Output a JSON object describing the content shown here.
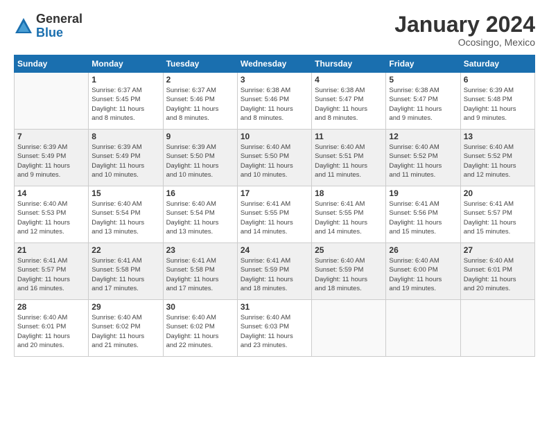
{
  "logo": {
    "general": "General",
    "blue": "Blue"
  },
  "title": "January 2024",
  "subtitle": "Ocosingo, Mexico",
  "days_header": [
    "Sunday",
    "Monday",
    "Tuesday",
    "Wednesday",
    "Thursday",
    "Friday",
    "Saturday"
  ],
  "weeks": [
    {
      "alt": false,
      "days": [
        {
          "num": "",
          "info": ""
        },
        {
          "num": "1",
          "info": "Sunrise: 6:37 AM\nSunset: 5:45 PM\nDaylight: 11 hours\nand 8 minutes."
        },
        {
          "num": "2",
          "info": "Sunrise: 6:37 AM\nSunset: 5:46 PM\nDaylight: 11 hours\nand 8 minutes."
        },
        {
          "num": "3",
          "info": "Sunrise: 6:38 AM\nSunset: 5:46 PM\nDaylight: 11 hours\nand 8 minutes."
        },
        {
          "num": "4",
          "info": "Sunrise: 6:38 AM\nSunset: 5:47 PM\nDaylight: 11 hours\nand 8 minutes."
        },
        {
          "num": "5",
          "info": "Sunrise: 6:38 AM\nSunset: 5:47 PM\nDaylight: 11 hours\nand 9 minutes."
        },
        {
          "num": "6",
          "info": "Sunrise: 6:39 AM\nSunset: 5:48 PM\nDaylight: 11 hours\nand 9 minutes."
        }
      ]
    },
    {
      "alt": true,
      "days": [
        {
          "num": "7",
          "info": "Sunrise: 6:39 AM\nSunset: 5:49 PM\nDaylight: 11 hours\nand 9 minutes."
        },
        {
          "num": "8",
          "info": "Sunrise: 6:39 AM\nSunset: 5:49 PM\nDaylight: 11 hours\nand 10 minutes."
        },
        {
          "num": "9",
          "info": "Sunrise: 6:39 AM\nSunset: 5:50 PM\nDaylight: 11 hours\nand 10 minutes."
        },
        {
          "num": "10",
          "info": "Sunrise: 6:40 AM\nSunset: 5:50 PM\nDaylight: 11 hours\nand 10 minutes."
        },
        {
          "num": "11",
          "info": "Sunrise: 6:40 AM\nSunset: 5:51 PM\nDaylight: 11 hours\nand 11 minutes."
        },
        {
          "num": "12",
          "info": "Sunrise: 6:40 AM\nSunset: 5:52 PM\nDaylight: 11 hours\nand 11 minutes."
        },
        {
          "num": "13",
          "info": "Sunrise: 6:40 AM\nSunset: 5:52 PM\nDaylight: 11 hours\nand 12 minutes."
        }
      ]
    },
    {
      "alt": false,
      "days": [
        {
          "num": "14",
          "info": "Sunrise: 6:40 AM\nSunset: 5:53 PM\nDaylight: 11 hours\nand 12 minutes."
        },
        {
          "num": "15",
          "info": "Sunrise: 6:40 AM\nSunset: 5:54 PM\nDaylight: 11 hours\nand 13 minutes."
        },
        {
          "num": "16",
          "info": "Sunrise: 6:40 AM\nSunset: 5:54 PM\nDaylight: 11 hours\nand 13 minutes."
        },
        {
          "num": "17",
          "info": "Sunrise: 6:41 AM\nSunset: 5:55 PM\nDaylight: 11 hours\nand 14 minutes."
        },
        {
          "num": "18",
          "info": "Sunrise: 6:41 AM\nSunset: 5:55 PM\nDaylight: 11 hours\nand 14 minutes."
        },
        {
          "num": "19",
          "info": "Sunrise: 6:41 AM\nSunset: 5:56 PM\nDaylight: 11 hours\nand 15 minutes."
        },
        {
          "num": "20",
          "info": "Sunrise: 6:41 AM\nSunset: 5:57 PM\nDaylight: 11 hours\nand 15 minutes."
        }
      ]
    },
    {
      "alt": true,
      "days": [
        {
          "num": "21",
          "info": "Sunrise: 6:41 AM\nSunset: 5:57 PM\nDaylight: 11 hours\nand 16 minutes."
        },
        {
          "num": "22",
          "info": "Sunrise: 6:41 AM\nSunset: 5:58 PM\nDaylight: 11 hours\nand 17 minutes."
        },
        {
          "num": "23",
          "info": "Sunrise: 6:41 AM\nSunset: 5:58 PM\nDaylight: 11 hours\nand 17 minutes."
        },
        {
          "num": "24",
          "info": "Sunrise: 6:41 AM\nSunset: 5:59 PM\nDaylight: 11 hours\nand 18 minutes."
        },
        {
          "num": "25",
          "info": "Sunrise: 6:40 AM\nSunset: 5:59 PM\nDaylight: 11 hours\nand 18 minutes."
        },
        {
          "num": "26",
          "info": "Sunrise: 6:40 AM\nSunset: 6:00 PM\nDaylight: 11 hours\nand 19 minutes."
        },
        {
          "num": "27",
          "info": "Sunrise: 6:40 AM\nSunset: 6:01 PM\nDaylight: 11 hours\nand 20 minutes."
        }
      ]
    },
    {
      "alt": false,
      "days": [
        {
          "num": "28",
          "info": "Sunrise: 6:40 AM\nSunset: 6:01 PM\nDaylight: 11 hours\nand 20 minutes."
        },
        {
          "num": "29",
          "info": "Sunrise: 6:40 AM\nSunset: 6:02 PM\nDaylight: 11 hours\nand 21 minutes."
        },
        {
          "num": "30",
          "info": "Sunrise: 6:40 AM\nSunset: 6:02 PM\nDaylight: 11 hours\nand 22 minutes."
        },
        {
          "num": "31",
          "info": "Sunrise: 6:40 AM\nSunset: 6:03 PM\nDaylight: 11 hours\nand 23 minutes."
        },
        {
          "num": "",
          "info": ""
        },
        {
          "num": "",
          "info": ""
        },
        {
          "num": "",
          "info": ""
        }
      ]
    }
  ]
}
